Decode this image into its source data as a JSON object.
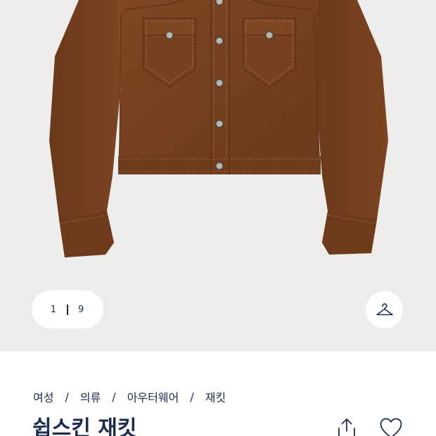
{
  "gallery": {
    "pager": {
      "current": "1",
      "total": "9"
    },
    "hanger_icon": "hanger-icon"
  },
  "breadcrumb": [
    {
      "label": "여성"
    },
    {
      "label": "의류"
    },
    {
      "label": "아우터웨어"
    },
    {
      "label": "재킷"
    }
  ],
  "breadcrumb_separator": "/",
  "product": {
    "title": "쉽스킨 재킷"
  },
  "actions": {
    "share_icon": "share-icon",
    "wishlist_icon": "heart-icon"
  },
  "colors": {
    "navy": "#1d2b4f",
    "gallery_bg": "#eeedeb",
    "suede": "#7a4321"
  }
}
